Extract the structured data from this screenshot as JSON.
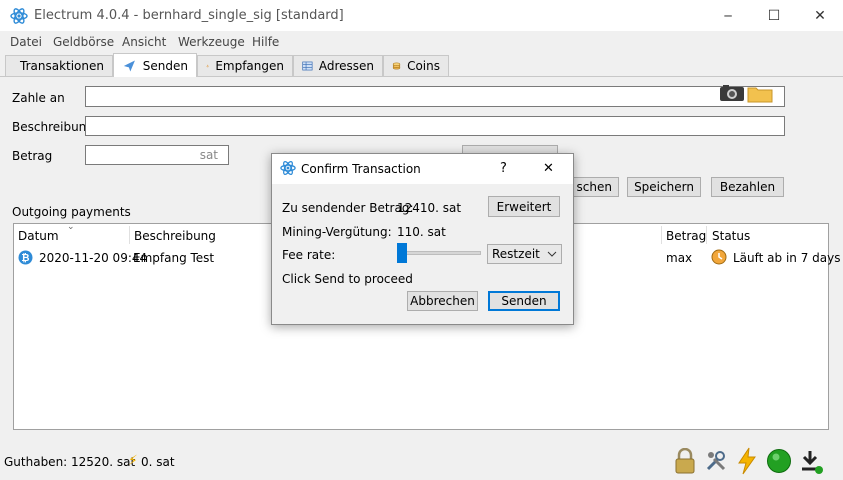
{
  "window": {
    "title": "Electrum 4.0.4  -  bernhard_single_sig  [standard]",
    "minimize": "─",
    "maximize": "☐",
    "close": "✕"
  },
  "menu": [
    "Datei",
    "Geldbörse",
    "Ansicht",
    "Werkzeuge",
    "Hilfe"
  ],
  "tabs": [
    {
      "label": "Transaktionen",
      "icon": "transactions-icon"
    },
    {
      "label": "Senden",
      "icon": "send-icon",
      "active": true
    },
    {
      "label": "Empfangen",
      "icon": "receive-icon"
    },
    {
      "label": "Adressen",
      "icon": "addresses-icon"
    },
    {
      "label": "Coins",
      "icon": "coins-icon"
    }
  ],
  "send_form": {
    "pay_to_label": "Zahle an",
    "pay_to_value": "",
    "description_label": "Beschreibung",
    "description_value": "",
    "amount_label": "Betrag",
    "amount_unit": "sat",
    "clear_button": "schen",
    "save_button": "Speichern",
    "pay_button": "Bezahlen"
  },
  "outgoing": {
    "heading": "Outgoing payments",
    "columns": {
      "date": "Datum",
      "description": "Beschreibung",
      "amount": "Betrag",
      "status": "Status"
    },
    "rows": [
      {
        "date": "2020-11-20 09:44",
        "description": "Empfang Test",
        "amount": "max",
        "status": "Läuft ab in 7 days"
      }
    ]
  },
  "statusbar": {
    "balance": "Guthaben: 12520. sat",
    "lightning": "0. sat"
  },
  "dialog": {
    "title": "Confirm Transaction",
    "help": "?",
    "close": "✕",
    "amount_label": "Zu sendender Betrag:",
    "amount_value": "12410. sat",
    "advanced_button": "Erweitert",
    "fee_label": "Mining-Vergütung:",
    "fee_value": "110. sat",
    "fee_rate_label": "Fee rate:",
    "fee_rate_slider": 0,
    "fee_mode": "Restzeit",
    "hint": "Click Send to proceed",
    "cancel_button": "Abbrechen",
    "send_button": "Senden"
  },
  "colors": {
    "accent": "#0078d7",
    "electrum_blue": "#2e8bd7",
    "bitcoin_orange": "#f7931a",
    "lightning_yellow": "#f5b400",
    "network_green": "#22a022"
  }
}
